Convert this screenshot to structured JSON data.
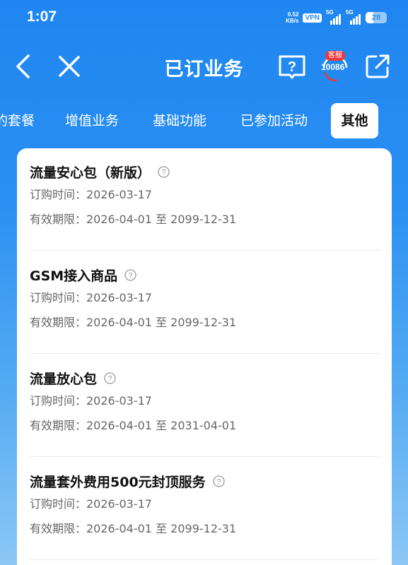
{
  "status_bar": {
    "time": "1:07",
    "net_speed_value": "0.52",
    "net_speed_unit": "KB/s",
    "vpn": "VPN",
    "signal1_label": "5G",
    "signal2_label": "5G",
    "battery": "28"
  },
  "nav": {
    "title": "已订业务",
    "service_badge": "客服",
    "service_number": "10086"
  },
  "tabs": [
    "的套餐",
    "增值业务",
    "基础功能",
    "已参加活动",
    "其他"
  ],
  "active_tab_index": 4,
  "items": [
    {
      "name": "流量安心包（新版）",
      "order_time": "订购时间：2026-03-17",
      "validity": "有效期限：2026-04-01 至 2099-12-31"
    },
    {
      "name": "GSM接入商品",
      "order_time": "订购时间：2026-03-17",
      "validity": "有效期限：2026-04-01 至 2099-12-31"
    },
    {
      "name": "流量放心包",
      "order_time": "订购时间：2026-03-17",
      "validity": "有效期限：2026-04-01 至 2031-04-01"
    },
    {
      "name": "流量套外费用500元封顶服务",
      "order_time": "订购时间：2026-03-17",
      "validity": "有效期限：2026-04-01 至 2099-12-31"
    }
  ],
  "colors": {
    "primary_blue": "#2a8ff2",
    "badge_red": "#f2373a",
    "card_bg": "#ffffff"
  }
}
